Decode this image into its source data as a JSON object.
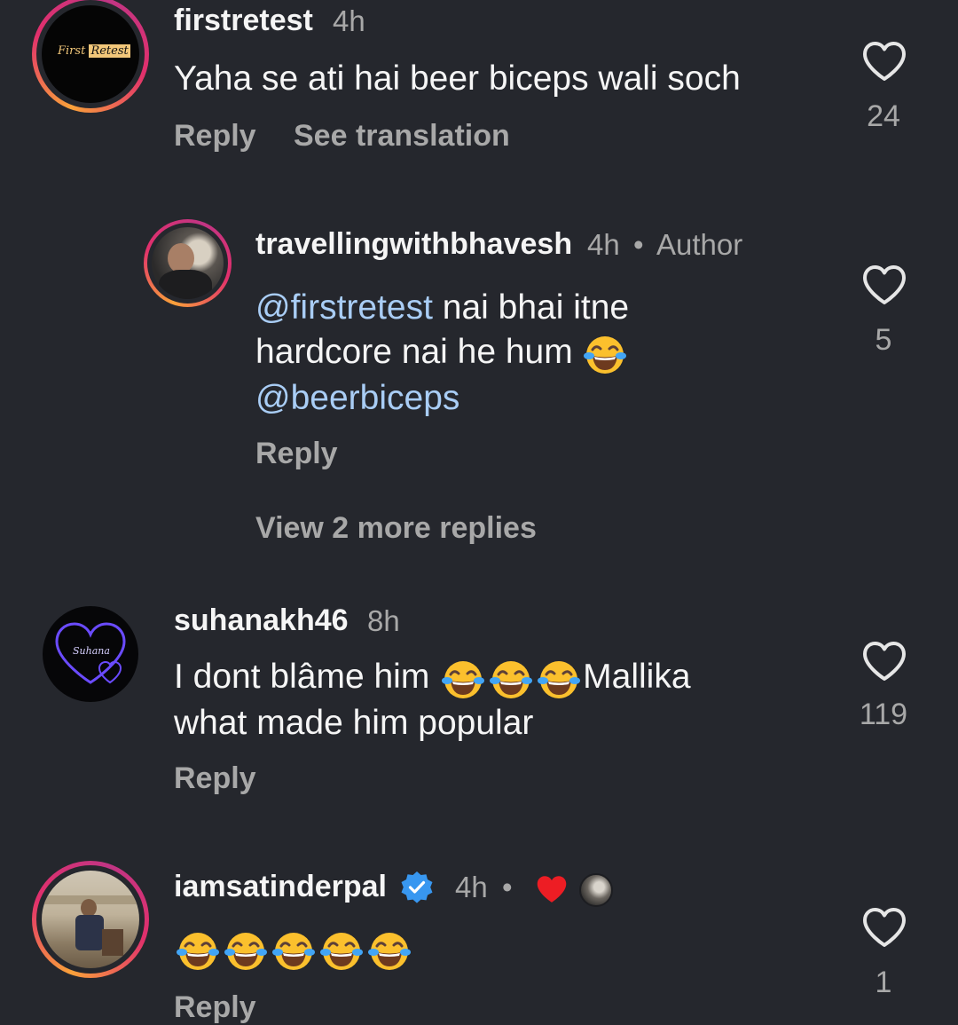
{
  "comments": [
    {
      "username": "firstretest",
      "time": "4h",
      "text": "Yaha se ati hai beer biceps wali soch",
      "reply_label": "Reply",
      "translate_label": "See translation",
      "likes": "24",
      "avatar_logo": [
        "First",
        "Retest"
      ]
    },
    {
      "username": "travellingwithbhavesh",
      "time": "4h",
      "separator": "•",
      "author_badge": "Author",
      "mention1": "@firstretest",
      "text1": " nai bhai itne",
      "text2": "hardcore nai he hum ",
      "mention2": "@beerbiceps",
      "reply_label": "Reply",
      "likes": "5"
    },
    {
      "view_more": "View 2 more replies"
    },
    {
      "username": "suhanakh46",
      "time": "8h",
      "text1": "I dont blâme  him ",
      "text1b": "Mallika",
      "text2": "what made him popular",
      "reply_label": "Reply",
      "likes": "119",
      "avatar_logo": "Suhana"
    },
    {
      "username": "iamsatinderpal",
      "time": "4h",
      "separator": "•",
      "reply_label": "Reply",
      "likes": "1"
    }
  ],
  "colors": {
    "background": "#25272d",
    "mention": "#a9cdf5",
    "muted": "#a8a8a8",
    "verified": "#3897f0",
    "heart_red": "#ed1d24"
  },
  "icons": [
    "heart-outline-icon",
    "verified-badge-icon",
    "heart-filled-icon",
    "laughing-emoji"
  ]
}
